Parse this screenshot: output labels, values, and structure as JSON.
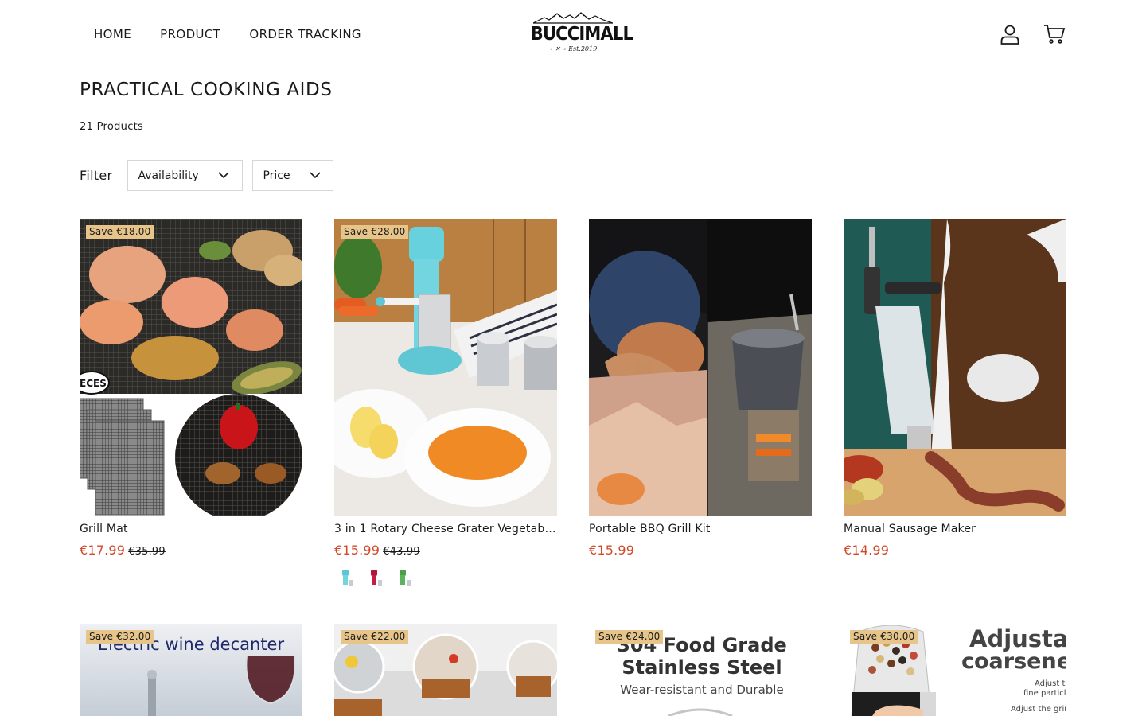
{
  "nav": {
    "items": [
      "HOME",
      "PRODUCT",
      "ORDER TRACKING"
    ]
  },
  "logo": {
    "name": "BUCCIMALL",
    "tagline": "Est.2019"
  },
  "header_icons": [
    "account-icon",
    "cart-icon"
  ],
  "collection": {
    "title": "PRACTICAL COOKING AIDS",
    "count": "21 Products",
    "filter_label": "Filter",
    "filters": [
      "Availability",
      "Price"
    ]
  },
  "colors": {
    "sale_price": "#d14b2a",
    "badge": "#e7c58a",
    "text": "#1a1a1a"
  },
  "products": [
    {
      "badge": "Save €18.00",
      "name": "Grill Mat",
      "price": "€17.99",
      "compare": "€35.99"
    },
    {
      "badge": "Save €28.00",
      "name": "3 in 1 Rotary Cheese Grater Vegetabl...",
      "price": "€15.99",
      "compare": "€43.99",
      "swatches": [
        "blue",
        "red",
        "green"
      ]
    },
    {
      "badge": "",
      "name": "Portable BBQ Grill Kit",
      "price": "€15.99",
      "compare": ""
    },
    {
      "badge": "",
      "name": "Manual Sausage Maker",
      "price": "€14.99",
      "compare": ""
    },
    {
      "badge": "Save €32.00",
      "image_text": "Electric wine decanter"
    },
    {
      "badge": "Save €22.00"
    },
    {
      "badge": "Save €24.00",
      "image_text": [
        "304 Food Grade",
        "Stainless Steel",
        "Wear-resistant and Durable"
      ]
    },
    {
      "badge": "Save €30.00",
      "image_text": [
        "Adjustal",
        "coarsene",
        "Adjust th",
        "fine particles",
        "Adjust the grind"
      ]
    }
  ]
}
